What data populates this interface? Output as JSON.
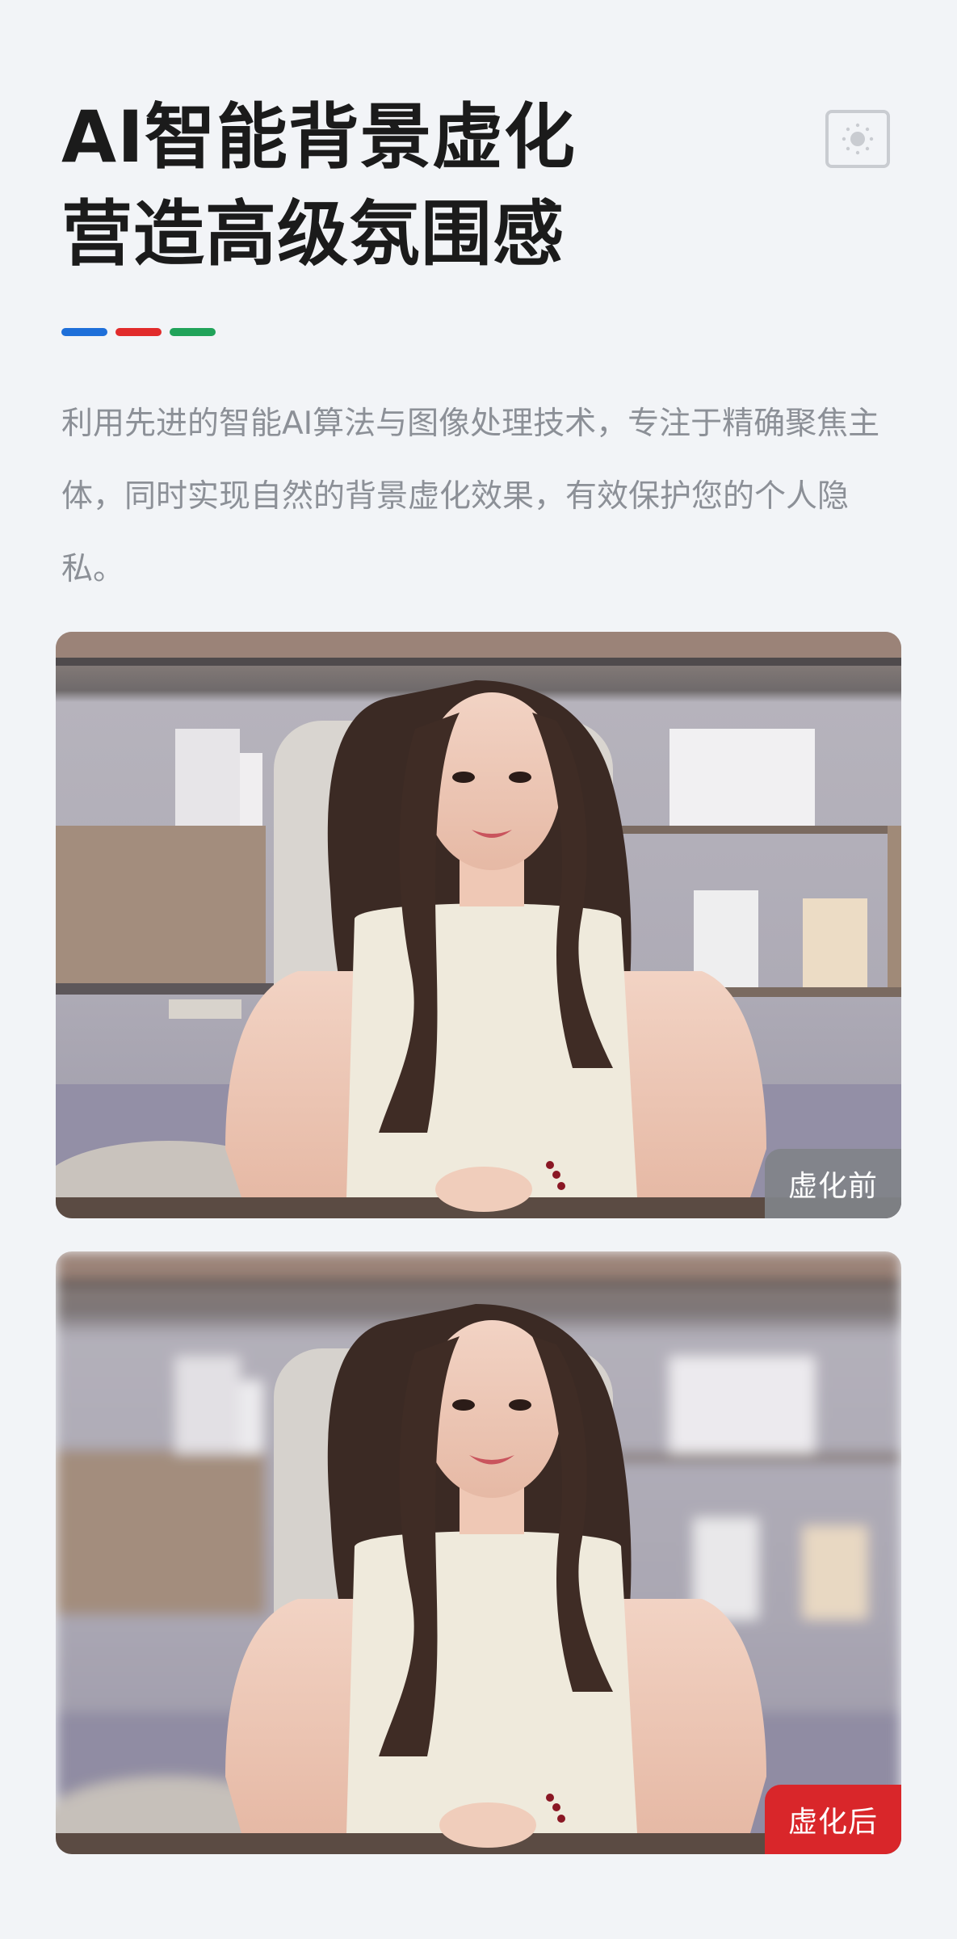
{
  "header": {
    "title_line1": "AI智能背景虚化",
    "title_line2": "营造高级氛围感",
    "icon": "background-blur-icon"
  },
  "accent_colors": [
    "#1e6fd9",
    "#e12b2b",
    "#21a35a"
  ],
  "description": "利用先进的智能AI算法与图像处理技术，专注于精确聚焦主体，同时实现自然的背景虚化效果，有效保护您的个人隐私。",
  "comparison": {
    "before_label": "虚化前",
    "after_label": "虚化后"
  },
  "colors": {
    "before_badge": "#808389",
    "after_badge": "#d9262a",
    "title_text": "#1b1b1b",
    "body_text": "#8c9097"
  }
}
